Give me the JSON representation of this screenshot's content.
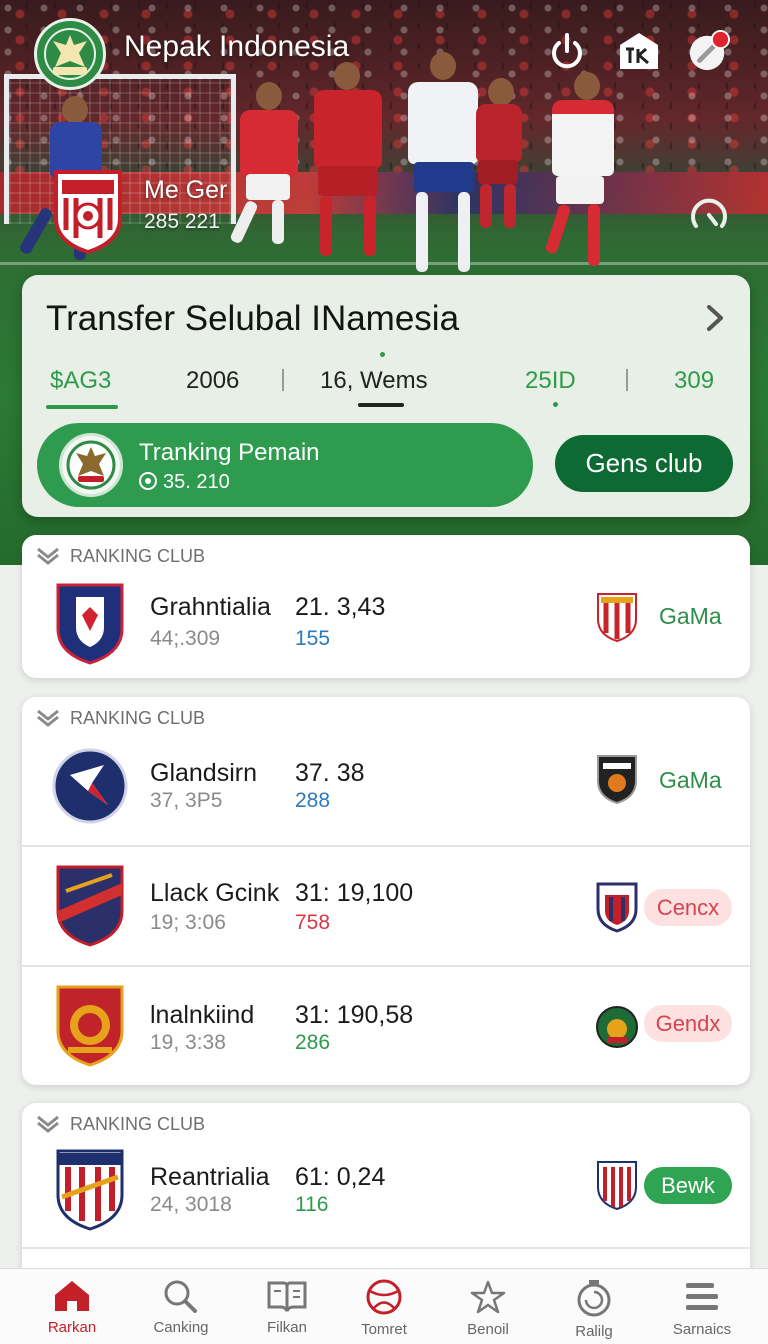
{
  "app": {
    "title": "Nepak Indonesia"
  },
  "hero": {
    "name": "Me Ger",
    "number": "285 221"
  },
  "transfer": {
    "title": "Transfer Selubal INamesia",
    "stats": [
      "$AG3",
      "2006",
      "16, Wems",
      "25ID",
      "309"
    ],
    "pill_label": "Tranking Pemain",
    "pill_sub": "35. 210",
    "button": "Gens club"
  },
  "sections": [
    {
      "header": "RANKING CLUB",
      "rows": [
        {
          "name": "Grahntialia",
          "sub": "44;.309",
          "score": "21. 3,43",
          "count": "155",
          "count_color": "#2a7ac0",
          "tag": "GaMa"
        }
      ]
    },
    {
      "header": "RANKING CLUB",
      "rows": [
        {
          "name": "Glandsirn",
          "sub": "37, 3P5",
          "score": "37. 38",
          "count": "288",
          "count_color": "#2a7ac0",
          "tag": "GaMa"
        },
        {
          "name": "Llack Gcink",
          "sub": "19; 3:06",
          "score": "31: 19,100",
          "count": "758",
          "count_color": "#d23a44",
          "pill": "Cencx"
        },
        {
          "name": "lnalnkiind",
          "sub": "19, 3:38",
          "score": "31: 190,58",
          "count": "286",
          "count_color": "#2e9b4a",
          "pill": "Gendx"
        }
      ]
    },
    {
      "header": "RANKING CLUB",
      "rows": [
        {
          "name": "Reantrialia",
          "sub": "24, 3018",
          "score": "61: 0,24",
          "count": "116",
          "count_color": "#2e9b4a",
          "pill": "Bewk"
        }
      ]
    }
  ],
  "nav": [
    {
      "label": "Rarkan",
      "icon": "home-icon",
      "active": true
    },
    {
      "label": "Canking",
      "icon": "search-icon"
    },
    {
      "label": "Filkan",
      "icon": "book-icon"
    },
    {
      "label": "Tomret",
      "icon": "ball-icon"
    },
    {
      "label": "Benoil",
      "icon": "star-icon"
    },
    {
      "label": "Ralilg",
      "icon": "timer-icon"
    },
    {
      "label": "Sarnaics",
      "icon": "menu-icon"
    }
  ],
  "colors": {
    "brand_green": "#2e9b4f",
    "dark_green": "#0d6a32",
    "accent_red": "#c42027"
  }
}
